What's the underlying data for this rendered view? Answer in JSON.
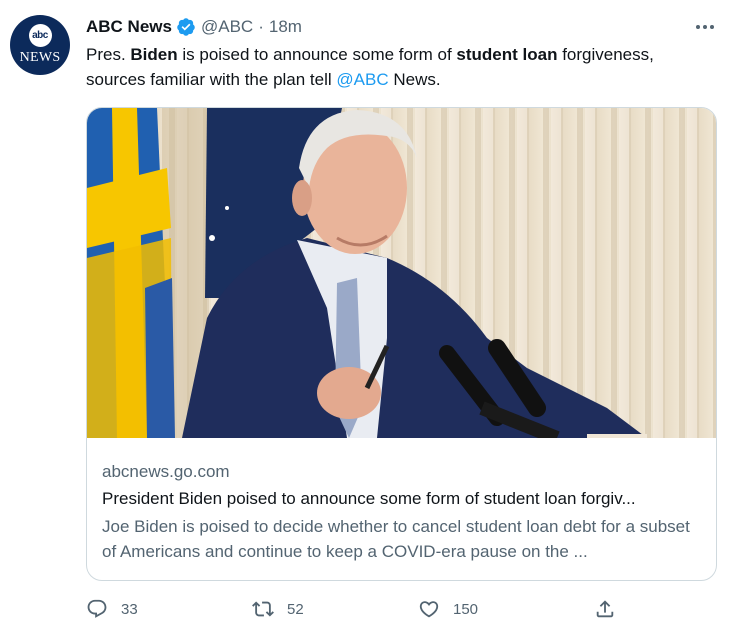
{
  "tweet": {
    "display_name": "ABC News",
    "handle": "@ABC",
    "separator": "·",
    "time": "18m",
    "text": {
      "part1": "Pres. ",
      "bold1": "Biden",
      "part2": " is poised to announce some form of ",
      "bold2": "student loan",
      "part3": " forgiveness, sources familiar with the plan tell ",
      "mention": "@ABC",
      "part4": " News."
    }
  },
  "avatar": {
    "logo_text": "abc",
    "logo_word": "NEWS"
  },
  "card": {
    "image_icon": "photo-joe-biden-at-podium",
    "domain": "abcnews.go.com",
    "title": "President Biden poised to announce some form of student loan forgiv...",
    "description": "Joe Biden is poised to decide whether to cancel student loan debt for a subset of Americans and continue to keep a COVID-era pause on the ..."
  },
  "actions": {
    "reply_count": "33",
    "retweet_count": "52",
    "like_count": "150"
  },
  "icons": {
    "verified": "verified-badge-icon",
    "more": "more-options-icon",
    "reply": "reply-icon",
    "retweet": "retweet-icon",
    "like": "heart-icon",
    "share": "share-icon"
  },
  "colors": {
    "accent": "#1d9bf0",
    "secondary_text": "#536471",
    "primary_text": "#0f1419",
    "border": "#cfd9de",
    "avatar_bg": "#0c2a5b"
  }
}
